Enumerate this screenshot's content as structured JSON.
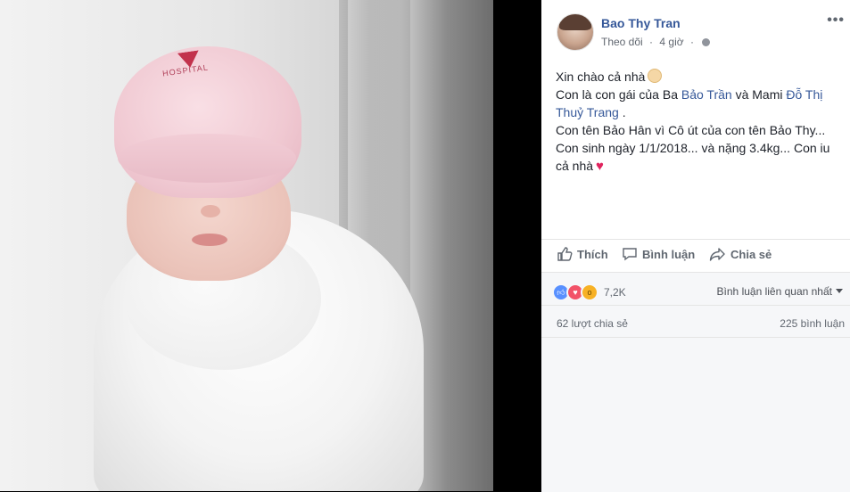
{
  "post": {
    "author": "Bao Thy Tran",
    "follow_label": "Theo dõi",
    "separator": "·",
    "time": "4 giờ",
    "more_label": "•••",
    "lines": {
      "l1": "Xin chào cả nhà",
      "l2_pre": "Con là con gái của Ba ",
      "l2_link1": "Bảo Trần",
      "l2_mid": " và Mami ",
      "l2_link2": "Đỗ Thị Thuỷ Trang",
      "l2_post": " .",
      "l3": "Con tên Bảo Hân vì Cô út của con tên Bảo Thy...",
      "l4": "Con sinh ngày 1/1/2018... và nặng 3.4kg... Con iu cả nhà"
    },
    "heart_glyph": "♥"
  },
  "photo": {
    "hat_text": "HOSPITAL"
  },
  "actions": {
    "like": "Thích",
    "comment": "Bình luận",
    "share": "Chia sẻ"
  },
  "stats": {
    "reaction_count": "7,2K",
    "comment_filter": "Bình luận liên quan nhất",
    "shares": "62 lượt chia sẻ",
    "comments": "225 bình luận"
  },
  "colors": {
    "link": "#365899",
    "like_reaction": "#5890ff",
    "love_reaction": "#f25268",
    "wow_reaction": "#f7b125",
    "heart": "#e0245e"
  },
  "icons": {
    "like": "thumbs-up-icon",
    "comment": "speech-bubble-icon",
    "share": "share-arrow-icon",
    "privacy": "globe-icon",
    "angel": "angel-emoji-icon"
  }
}
